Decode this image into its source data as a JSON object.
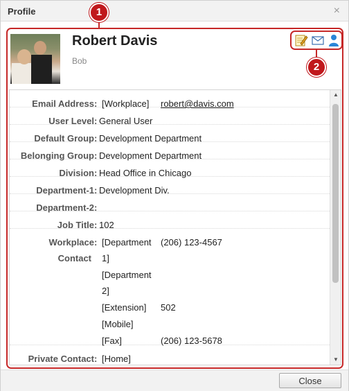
{
  "dialog": {
    "title": "Profile",
    "close_glyph": "×",
    "close_button_label": "Close"
  },
  "callouts": [
    "1",
    "2"
  ],
  "profile": {
    "name": "Robert Davis",
    "nickname": "Bob",
    "photo_alt": "profile-photo",
    "actions": [
      {
        "name": "edit-icon",
        "color": "#e0a020"
      },
      {
        "name": "mail-icon",
        "color": "#3a6fb0"
      },
      {
        "name": "user-icon",
        "color": "#2a86d8"
      }
    ]
  },
  "fields": {
    "email": {
      "label": "Email Address",
      "tag": "[Workplace]",
      "value": "robert@davis.com"
    },
    "user_level": {
      "label": "User Level",
      "value": "General User"
    },
    "default_group": {
      "label": "Default Group",
      "value": "Development Department"
    },
    "belonging_group": {
      "label": "Belonging Group",
      "value": "Development Department"
    },
    "division": {
      "label": "Division",
      "value": "Head Office in Chicago"
    },
    "department1": {
      "label": "Department-1",
      "value": "Development Div."
    },
    "department2": {
      "label": "Department-2",
      "value": ""
    },
    "job_title": {
      "label": "Job Title",
      "value": "102"
    },
    "workplace_contact": {
      "label_line1": "Workplace",
      "label_line2": "Contact",
      "entries": [
        {
          "tag_line1": "[Department",
          "tag_line2": "1]",
          "value": "(206) 123-4567"
        },
        {
          "tag_line1": "[Department",
          "tag_line2": "2]",
          "value": ""
        },
        {
          "tag_line1": "[Extension]",
          "tag_line2": "",
          "value": "502"
        },
        {
          "tag_line1": "[Mobile]",
          "tag_line2": "",
          "value": ""
        },
        {
          "tag_line1": "[Fax]",
          "tag_line2": "",
          "value": "(206) 123-5678"
        }
      ]
    },
    "private_contact": {
      "label": "Private Contact",
      "tag": "[Home]",
      "value": ""
    }
  },
  "colors": {
    "highlight": "#c62828",
    "link": "#1a0dab"
  }
}
